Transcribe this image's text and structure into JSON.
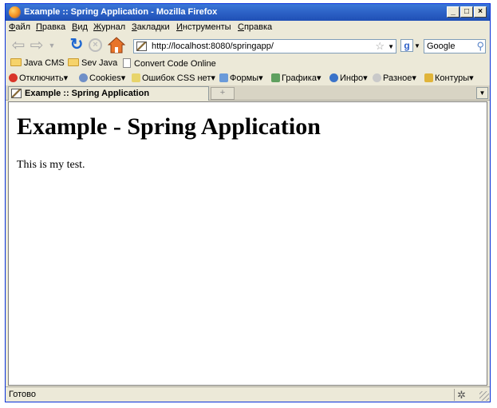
{
  "window": {
    "title": "Example :: Spring Application - Mozilla Firefox",
    "buttons": {
      "minimize": "_",
      "maximize": "□",
      "close": "×"
    }
  },
  "menu": [
    "Файл",
    "Правка",
    "Вид",
    "Журнал",
    "Закладки",
    "Инструменты",
    "Справка"
  ],
  "nav": {
    "url": "http://localhost:8080/springapp/",
    "search_placeholder": "Google"
  },
  "bookmarks": [
    {
      "label": "Java CMS",
      "icon": "folder-icon"
    },
    {
      "label": "Sev Java",
      "icon": "folder-icon"
    },
    {
      "label": "Convert Code Online",
      "icon": "page-icon"
    }
  ],
  "devtoolbar": [
    {
      "label": "Отключить",
      "icon": "disable-icon",
      "color": "#d9352a"
    },
    {
      "label": "Cookies",
      "icon": "cookies-icon",
      "color": "#6f8fc7"
    },
    {
      "label": "Ошибок CSS нет",
      "icon": "css-icon",
      "color": "#e8d46a"
    },
    {
      "label": "Формы",
      "icon": "forms-icon",
      "color": "#6a9ad9"
    },
    {
      "label": "Графика",
      "icon": "images-icon",
      "color": "#5fa05f"
    },
    {
      "label": "Инфо",
      "icon": "info-icon",
      "color": "#3a73c9"
    },
    {
      "label": "Разное",
      "icon": "misc-icon",
      "color": "#c9c9c9"
    },
    {
      "label": "Контуры",
      "icon": "outline-icon",
      "color": "#e0b43a"
    }
  ],
  "tabs": [
    {
      "title": "Example :: Spring Application",
      "active": true
    }
  ],
  "page": {
    "heading": "Example - Spring Application",
    "paragraph": "This is my test."
  },
  "status": {
    "text": "Готово"
  }
}
